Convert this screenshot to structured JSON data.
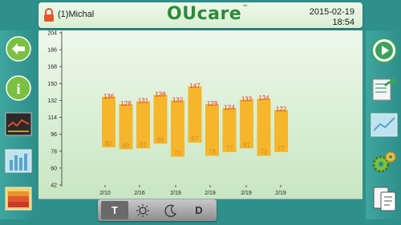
{
  "header": {
    "user": "(1)Michal",
    "logo": "OUcare",
    "logo_tm": "™",
    "date": "2015-02-19",
    "time": "18:54"
  },
  "colors": {
    "bar": "#f5b62c",
    "value_hi": "#e0362f",
    "value_lo": "#d08a2a",
    "accent_green": "#2d8a39"
  },
  "left_buttons": [
    {
      "icon": "back-arrow-icon"
    },
    {
      "icon": "info-icon"
    },
    {
      "icon": "line-chart-icon"
    },
    {
      "icon": "bar-chart-icon"
    },
    {
      "icon": "area-chart-icon"
    }
  ],
  "right_buttons": [
    {
      "icon": "play-icon"
    },
    {
      "icon": "export-report-icon"
    },
    {
      "icon": "chart-view-icon"
    },
    {
      "icon": "settings-gears-icon"
    },
    {
      "icon": "devices-icon"
    }
  ],
  "toolbar": {
    "buttons": [
      {
        "label": "T",
        "icon": "",
        "active": true
      },
      {
        "label": "",
        "icon": "sun-icon",
        "active": false
      },
      {
        "label": "",
        "icon": "moon-icon",
        "active": false
      },
      {
        "label": "D",
        "icon": "",
        "active": false
      }
    ]
  },
  "chart_data": {
    "type": "bar",
    "ylim": [
      42,
      204
    ],
    "yticks": [
      42,
      60,
      78,
      96,
      114,
      132,
      150,
      168,
      186,
      204
    ],
    "xlabels": [
      "2/10",
      "2/16",
      "2/19",
      "2/19",
      "2/19",
      "2/19"
    ],
    "series": [
      {
        "values_high": [
          136,
          128,
          131,
          138,
          132,
          147,
          128,
          124,
          133,
          134,
          122
        ],
        "values_low": [
          82,
          80,
          81,
          86,
          72,
          87,
          73,
          77,
          81,
          73,
          77
        ]
      }
    ]
  }
}
